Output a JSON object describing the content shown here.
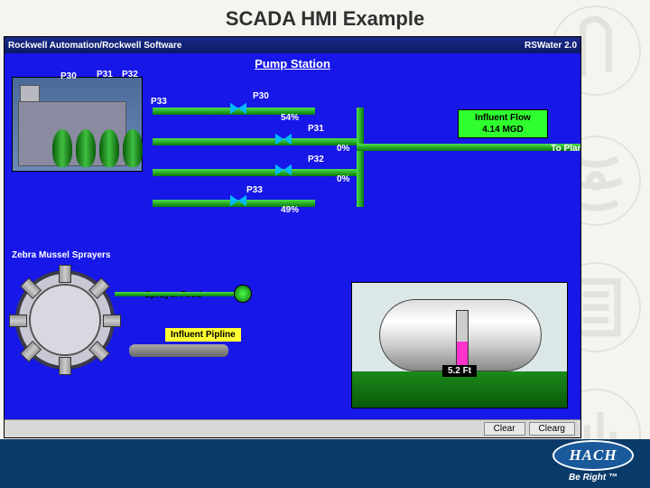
{
  "slide": {
    "title": "SCADA HMI Example"
  },
  "titlebar": {
    "left": "Rockwell Automation/Rockwell Software",
    "right": "RSWater 2.0"
  },
  "station": {
    "title": "Pump Station"
  },
  "pumps": [
    {
      "id": "P30",
      "label": "P30"
    },
    {
      "id": "P31",
      "label": "P31"
    },
    {
      "id": "P32",
      "label": "P32"
    },
    {
      "id": "P33",
      "label": "P33"
    }
  ],
  "lines": [
    {
      "id": "P30",
      "label": "P30",
      "pct": "54%"
    },
    {
      "id": "P31",
      "label": "P31",
      "pct": "0%"
    },
    {
      "id": "P32",
      "label": "P32",
      "pct": "0%"
    },
    {
      "id": "P33",
      "label": "P33",
      "pct": "49%"
    }
  ],
  "flowbox": {
    "title": "Influent Flow",
    "value": "4.14 MGD"
  },
  "to_plant": "To Plant",
  "zebra": {
    "title": "Zebra Mussel Sprayers"
  },
  "sprayer_feed": "Sprayer Feed",
  "influent_pipeline": "Influent Pipline",
  "tank": {
    "level_text": "5.2 Ft"
  },
  "buttons": {
    "clear": "Clear",
    "clearg": "Clearg"
  },
  "logo": {
    "brand": "HACH",
    "tagline": "Be Right ™"
  }
}
